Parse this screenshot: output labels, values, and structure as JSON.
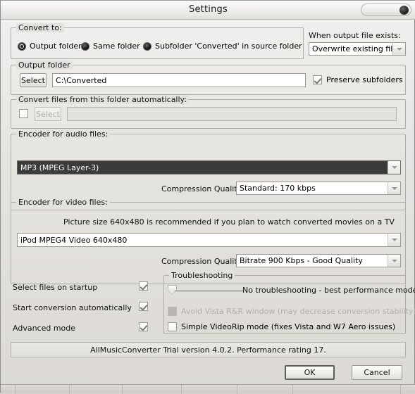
{
  "window": {
    "title": "Settings",
    "close_button": "close-button"
  },
  "convert_to": {
    "legend": "Convert to:",
    "options": [
      {
        "label": "Output folder",
        "selected": true
      },
      {
        "label": "Same folder",
        "selected": false
      },
      {
        "label": "Subfolder 'Converted' in source folder",
        "selected": false
      }
    ]
  },
  "output_exists": {
    "label": "When output file exists:",
    "value": "Overwrite existing file"
  },
  "output_folder": {
    "legend": "Output folder",
    "select_button": "Select",
    "path_value": "C:\\Converted",
    "preserve_subfolders_label": "Preserve subfolders",
    "preserve_subfolders_checked": true
  },
  "auto_folder": {
    "legend": "Convert files from this folder automatically:",
    "enabled_checked": false,
    "select_button": "Select",
    "path_value": ""
  },
  "audio_encoder": {
    "legend": "Encoder for audio files:",
    "encoder_value": "MP3 (MPEG Layer-3)",
    "quality_label": "Compression Quality",
    "quality_value": "Standard: 170 kbps"
  },
  "video_encoder": {
    "legend": "Encoder for video files:",
    "hint": "Picture size 640x480 is recommended if you plan to watch converted movies on a TV",
    "encoder_value": "iPod MPEG4 Video 640x480",
    "quality_label": "Compression Quality",
    "quality_value": "Bitrate 900 Kbps - Good Quality"
  },
  "options": [
    {
      "label": "Select files on startup",
      "checked": true
    },
    {
      "label": "Start conversion automatically",
      "checked": true
    },
    {
      "label": "Advanced mode",
      "checked": true
    }
  ],
  "troubleshooting": {
    "legend": "Troubleshooting",
    "slider_value": 0,
    "slider_text": "No troubleshooting - best performance mode",
    "avoid_vista_label": "Avoid Vista R&R window (may decrease conversion stability!)",
    "avoid_vista_checked": false,
    "avoid_vista_disabled": true,
    "simple_videorip_label": "Simple VideoRip mode (fixes Vista and W7 Aero issues)",
    "simple_videorip_checked": false
  },
  "statusbar": {
    "text": "AllMusicConverter Trial version 4.0.2. Performance rating 17."
  },
  "buttons": {
    "ok": "OK",
    "cancel": "Cancel"
  },
  "colors": {
    "dialog_bg": "#e4e2de",
    "selected_combo_bg": "#3b3b3b",
    "border": "#b0aca6"
  }
}
